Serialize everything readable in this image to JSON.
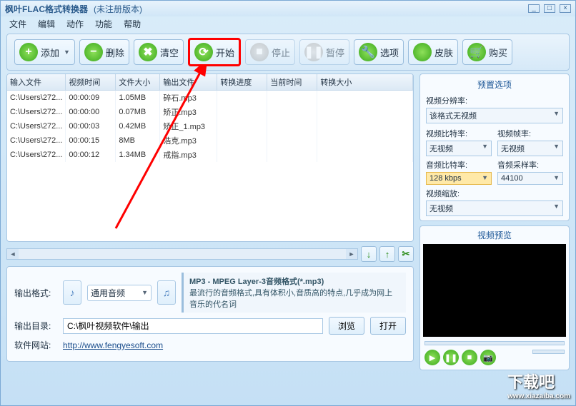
{
  "title": {
    "main": "枫叶FLAC格式转换器",
    "sub": "(未注册版本)"
  },
  "menu": {
    "file": "文件",
    "edit": "编辑",
    "action": "动作",
    "func": "功能",
    "help": "帮助"
  },
  "toolbar": {
    "add": "添加",
    "remove": "删除",
    "clear": "清空",
    "start": "开始",
    "stop": "停止",
    "pause": "暂停",
    "options": "选项",
    "skin": "皮肤",
    "buy": "购买"
  },
  "table": {
    "headers": {
      "input": "输入文件",
      "vtime": "视频时间",
      "size": "文件大小",
      "output": "输出文件",
      "progress": "转换进度",
      "curtime": "当前时间",
      "osize": "转换大小"
    },
    "rows": [
      {
        "input": "C:\\Users\\272...",
        "vtime": "00:00:09",
        "size": "1.05MB",
        "output": "碎石.mp3"
      },
      {
        "input": "C:\\Users\\272...",
        "vtime": "00:00:00",
        "size": "0.07MB",
        "output": "矫正.mp3"
      },
      {
        "input": "C:\\Users\\272...",
        "vtime": "00:00:03",
        "size": "0.42MB",
        "output": "矫正_1.mp3"
      },
      {
        "input": "C:\\Users\\272...",
        "vtime": "00:00:15",
        "size": "8MB",
        "output": "浩克.mp3"
      },
      {
        "input": "C:\\Users\\272...",
        "vtime": "00:00:12",
        "size": "1.34MB",
        "output": "戒指.mp3"
      }
    ]
  },
  "output": {
    "fmt_label": "输出格式:",
    "fmt_value": "通用音频",
    "fmt_title": "MP3 - MPEG Layer-3音频格式(*.mp3)",
    "fmt_desc": "最流行的音频格式,具有体积小,音质高的特点,几乎成为网上音乐的代名词",
    "dir_label": "输出目录:",
    "dir_value": "C:\\枫叶视频软件\\输出",
    "browse": "浏览",
    "open": "打开",
    "site_label": "软件网站:",
    "site_url": "http://www.fengyesoft.com"
  },
  "opts": {
    "title": "预置选项",
    "vres_label": "视频分辨率:",
    "vres_value": "该格式无视频",
    "vbr_label": "视频比特率:",
    "vbr_value": "无视频",
    "fps_label": "视频帧率:",
    "fps_value": "无视频",
    "abr_label": "音频比特率:",
    "abr_value": "128 kbps",
    "asr_label": "音频采样率:",
    "asr_value": "44100",
    "vzoom_label": "视频缩放:",
    "vzoom_value": "无视频"
  },
  "preview": {
    "title": "视频预览"
  },
  "watermark": {
    "text": "下载吧",
    "url": "www.xiazaiba.com"
  }
}
